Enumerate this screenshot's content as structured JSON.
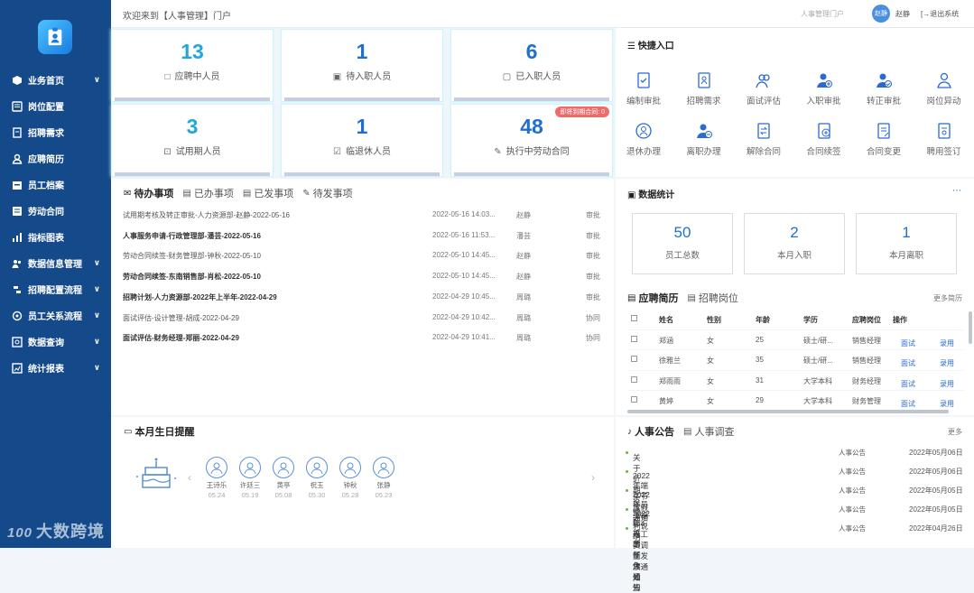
{
  "header": {
    "welcome": "欢迎来到【人事管理】门户",
    "system_switch": "人事管理门户",
    "avatar_text": "赵静",
    "user_name": "赵静",
    "logout": "退出系统"
  },
  "sidebar": {
    "items": [
      {
        "label": "业务首页",
        "icon": "cube-icon",
        "has_chevron": true
      },
      {
        "label": "岗位配置",
        "icon": "list-icon",
        "has_chevron": false
      },
      {
        "label": "招聘需求",
        "icon": "doc-icon",
        "has_chevron": false
      },
      {
        "label": "应聘简历",
        "icon": "user-icon",
        "has_chevron": false
      },
      {
        "label": "员工档案",
        "icon": "archive-icon",
        "has_chevron": false
      },
      {
        "label": "劳动合同",
        "icon": "contract-icon",
        "has_chevron": false
      },
      {
        "label": "指标图表",
        "icon": "chart-icon",
        "has_chevron": false
      },
      {
        "label": "数据信息管理",
        "icon": "users-icon",
        "has_chevron": true
      },
      {
        "label": "招聘配置流程",
        "icon": "flow-icon",
        "has_chevron": true
      },
      {
        "label": "员工关系流程",
        "icon": "relation-icon",
        "has_chevron": true
      },
      {
        "label": "数据查询",
        "icon": "query-icon",
        "has_chevron": true
      },
      {
        "label": "统计报表",
        "icon": "report-icon",
        "has_chevron": true
      }
    ],
    "brand": "大数跨境",
    "brand_mark": "100"
  },
  "stats": [
    {
      "value": "13",
      "label": "应聘中人员",
      "color": "#21a8d9"
    },
    {
      "value": "1",
      "label": "待入职人员",
      "color": "#1e6fd0"
    },
    {
      "value": "6",
      "label": "已入职人员",
      "color": "#1e6fd0"
    },
    {
      "value": "3",
      "label": "试用期人员",
      "color": "#21a8d9"
    },
    {
      "value": "1",
      "label": "临退休人员",
      "color": "#1e6fd0"
    },
    {
      "value": "48",
      "label": "执行中劳动合同",
      "color": "#1e6fd0",
      "tag": "即将到期合同: 0"
    }
  ],
  "todo": {
    "tabs": [
      "待办事项",
      "已办事项",
      "已发事项",
      "待发事项"
    ],
    "rows": [
      {
        "title": "试用期考核及转正审批-人力资源部-赵静-2022-05-16",
        "time": "2022-05-16 14:03...",
        "person": "赵静",
        "type": "审批",
        "bold": false
      },
      {
        "title": "人事服务申请-行政管理部-潘芸-2022-05-16",
        "time": "2022-05-16 11:53...",
        "person": "潘芸",
        "type": "审批",
        "bold": true
      },
      {
        "title": "劳动合同续签-财务管理部-钟秋-2022-05-10",
        "time": "2022-05-10 14:45...",
        "person": "赵静",
        "type": "审批",
        "bold": false
      },
      {
        "title": "劳动合同续签-东南销售部-肖松-2022-05-10",
        "time": "2022-05-10 14:45...",
        "person": "赵静",
        "type": "审批",
        "bold": true
      },
      {
        "title": "招聘计划-人力资源部-2022年上半年-2022-04-29",
        "time": "2022-04-29 10:45...",
        "person": "周璐",
        "type": "审批",
        "bold": true
      },
      {
        "title": "面试评估-设计管理-胡成-2022-04-29",
        "time": "2022-04-29 10:42...",
        "person": "周璐",
        "type": "协同",
        "bold": false
      },
      {
        "title": "面试评估-财务经理-郑丽-2022-04-29",
        "time": "2022-04-29 10:41...",
        "person": "周璐",
        "type": "协同",
        "bold": true
      }
    ]
  },
  "birthday": {
    "title": "本月生日提醒",
    "people": [
      {
        "name": "王诗乐",
        "date": "05.24"
      },
      {
        "name": "许廷三",
        "date": "05.19"
      },
      {
        "name": "黄亭",
        "date": "05.08"
      },
      {
        "name": "祝玉",
        "date": "05.30"
      },
      {
        "name": "钟秋",
        "date": "05.28"
      },
      {
        "name": "张静",
        "date": "05.23"
      }
    ]
  },
  "quick": {
    "title": "快捷入口",
    "items": [
      {
        "label": "编制审批",
        "icon": "approval-icon"
      },
      {
        "label": "招聘需求",
        "icon": "recruit-icon"
      },
      {
        "label": "面试评估",
        "icon": "interview-icon"
      },
      {
        "label": "入职审批",
        "icon": "user-add-icon"
      },
      {
        "label": "转正审批",
        "icon": "user-check-icon"
      },
      {
        "label": "岗位异动",
        "icon": "user-transfer-icon"
      },
      {
        "label": "退休办理",
        "icon": "retire-icon"
      },
      {
        "label": "离职办理",
        "icon": "user-remove-icon"
      },
      {
        "label": "解除合同",
        "icon": "terminate-icon"
      },
      {
        "label": "合同续签",
        "icon": "renew-icon"
      },
      {
        "label": "合同变更",
        "icon": "change-icon"
      },
      {
        "label": "聘用签订",
        "icon": "sign-icon"
      }
    ]
  },
  "datastats": {
    "title": "数据统计",
    "cards": [
      {
        "value": "50",
        "label": "员工总数"
      },
      {
        "value": "2",
        "label": "本月入职"
      },
      {
        "value": "1",
        "label": "本月离职"
      }
    ]
  },
  "resume": {
    "tabs": [
      "应聘简历",
      "招聘岗位"
    ],
    "more": "更多简历",
    "columns": [
      "姓名",
      "性别",
      "年龄",
      "学历",
      "应聘岗位",
      "操作"
    ],
    "rows": [
      {
        "name": "郑涵",
        "gender": "女",
        "age": "25",
        "edu": "硕士/研...",
        "position": "销售经理",
        "a1": "面试",
        "a2": "录用"
      },
      {
        "name": "徐雅兰",
        "gender": "女",
        "age": "35",
        "edu": "硕士/研...",
        "position": "销售经理",
        "a1": "面试",
        "a2": "录用"
      },
      {
        "name": "郑雨雨",
        "gender": "女",
        "age": "31",
        "edu": "大学本科",
        "position": "财务经理",
        "a1": "面试",
        "a2": "录用"
      },
      {
        "name": "黄婷",
        "gender": "女",
        "age": "29",
        "edu": "大学本科",
        "position": "财务管理",
        "a1": "面试",
        "a2": "录用"
      }
    ]
  },
  "notice": {
    "tabs": [
      "人事公告",
      "人事调查"
    ],
    "more": "更多",
    "rows": [
      {
        "title": "关于近期疫情防控的工作通知",
        "type": "人事公告",
        "date": "2022年05月06日"
      },
      {
        "title": "2022年端午节放假通知",
        "type": "人事公告",
        "date": "2022年05月06日"
      },
      {
        "title": "2022年员工福利说明",
        "type": "人事公告",
        "date": "2022年05月05日"
      },
      {
        "title": "2022年4月工资调整发放通知",
        "type": "人事公告",
        "date": "2022年05月05日"
      },
      {
        "title": "人事任免公告",
        "type": "人事公告",
        "date": "2022年04月26日"
      }
    ]
  }
}
